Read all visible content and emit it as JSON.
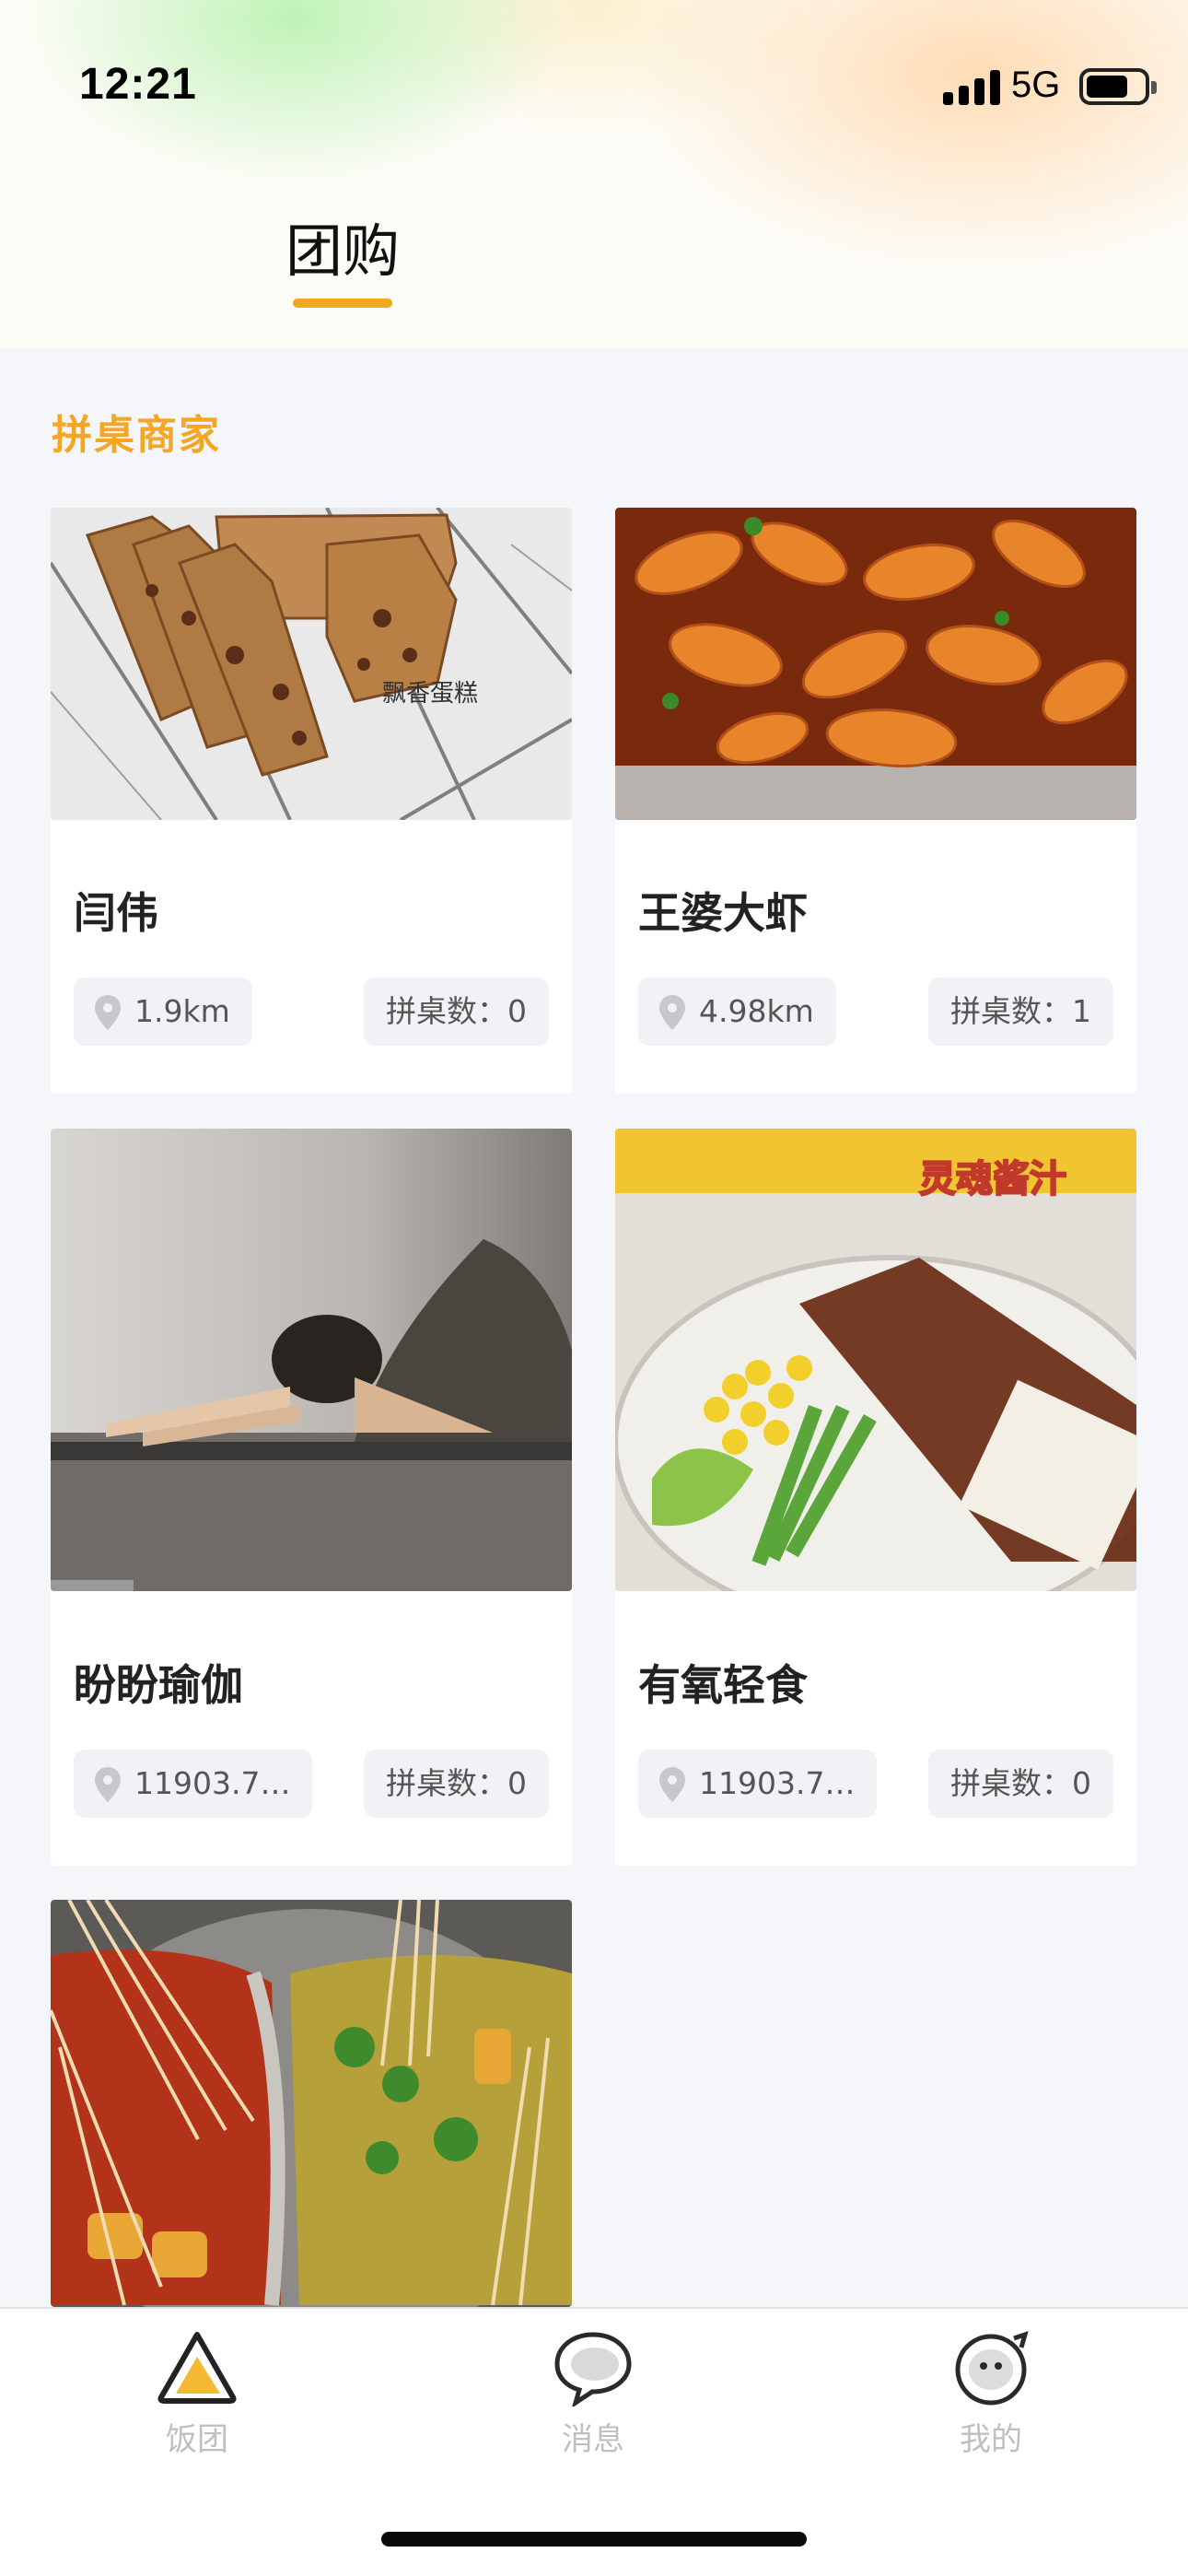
{
  "status_bar": {
    "time": "12:21",
    "network": "5G"
  },
  "header": {
    "tab_title": "团购"
  },
  "section": {
    "title": "拼桌商家"
  },
  "merchants": [
    {
      "name": "闫伟",
      "distance": "1.9km",
      "count_label": "拼桌数：",
      "count": "0",
      "image": "bread-loaf-photo",
      "watermark": "飘香蛋糕"
    },
    {
      "name": "王婆大虾",
      "distance": "4.98km",
      "count_label": "拼桌数：",
      "count": "1",
      "image": "spicy-shrimp-photo"
    },
    {
      "name": "盼盼瑜伽",
      "distance": "11903.7…",
      "count_label": "拼桌数：",
      "count": "0",
      "image": "yoga-pose-photo"
    },
    {
      "name": "有氧轻食",
      "distance": "11903.7…",
      "count_label": "拼桌数：",
      "count": "0",
      "image": "salad-sauce-photo",
      "overlay_text": "灵魂酱汁"
    },
    {
      "name": "",
      "image": "hotpot-skewers-photo"
    }
  ],
  "tabbar": {
    "items": [
      {
        "label": "饭团",
        "icon": "fantuan-icon"
      },
      {
        "label": "消息",
        "icon": "message-bubble-icon"
      },
      {
        "label": "我的",
        "icon": "profile-face-icon"
      }
    ]
  },
  "colors": {
    "accent": "#f5a623",
    "page_bg": "#f4f6fa",
    "pill_bg": "#f1f2f5",
    "tab_inactive": "#bfbfbf"
  }
}
